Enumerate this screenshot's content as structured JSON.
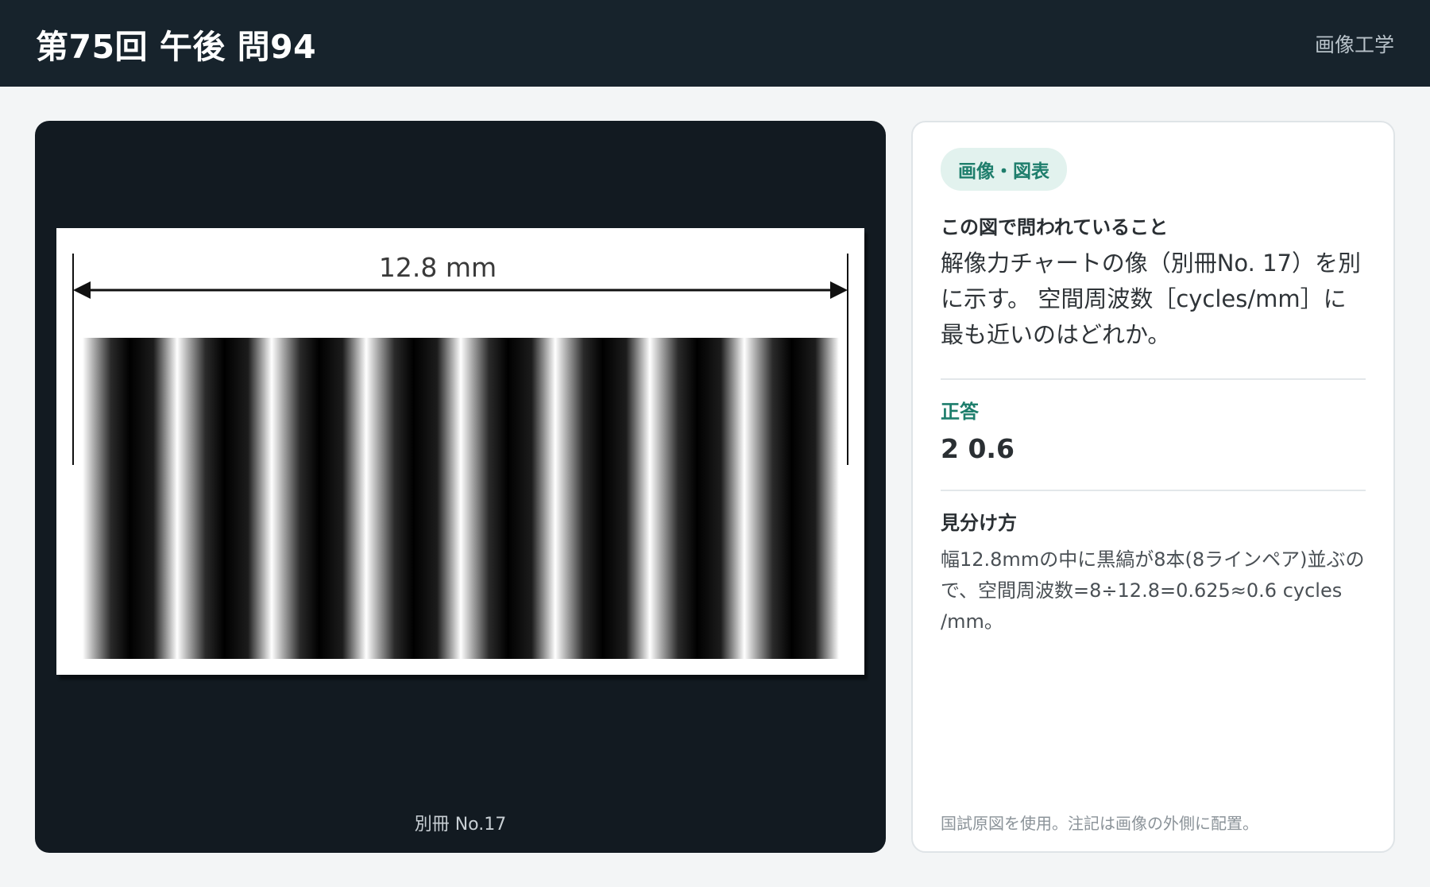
{
  "header": {
    "title": "第75回 午後 問94",
    "category": "画像工学"
  },
  "figure": {
    "dimension_label": "12.8 mm",
    "line_pair_count": 8,
    "caption": "別冊 No.17"
  },
  "info": {
    "badge": "画像・図表",
    "question_heading": "この図で問われていること",
    "question_text": "解像力チャートの像（別冊No. 17）を別に示す。 空間周波数［cycles/mm］に最も近いのはどれか。",
    "answer_label": "正答",
    "answer": "2 0.6",
    "explain_heading": "見分け方",
    "explain_text": "幅12.8mmの中に黒縞が8本(8ラインペア)並ぶので、空間周波数=8÷12.8=0.625≈0.6 cycles /mm。",
    "note": "国試原図を使用。注記は画像の外側に配置。"
  }
}
